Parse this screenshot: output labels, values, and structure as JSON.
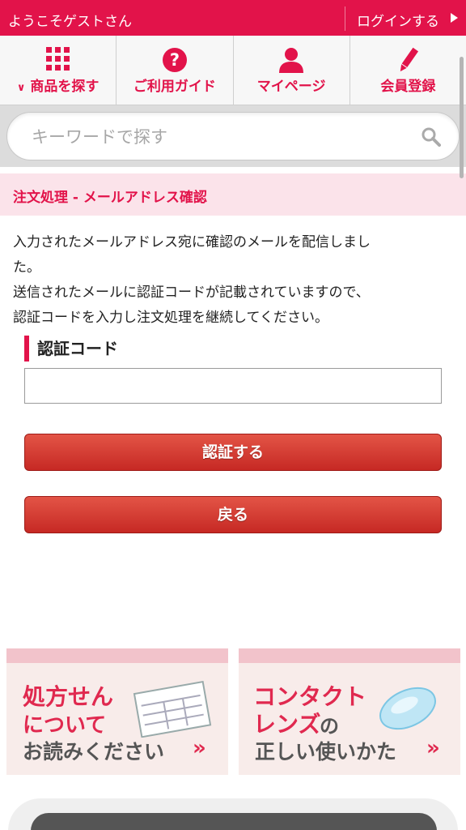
{
  "topbar": {
    "welcome": "ようこそゲストさん",
    "login_label": "ログインする"
  },
  "nav": {
    "items": [
      {
        "label": "商品を探す",
        "icon": "grid-icon"
      },
      {
        "label": "ご利用ガイド",
        "icon": "help-icon"
      },
      {
        "label": "マイページ",
        "icon": "user-icon"
      },
      {
        "label": "会員登録",
        "icon": "pencil-icon"
      }
    ]
  },
  "search": {
    "placeholder": "キーワードで探す",
    "value": ""
  },
  "page": {
    "title": "注文処理 - メールアドレス確認",
    "intro_lines": [
      "入力されたメールアドレス宛に確認のメールを配信しまし",
      "た。",
      "送信されたメールに認証コードが記載されていますので、",
      "認証コードを入力し注文処理を継続してください。"
    ]
  },
  "form": {
    "code_label": "認証コード",
    "code_value": "",
    "submit_label": "認証する",
    "back_label": "戻る"
  },
  "banners": {
    "prescription": {
      "line1": "処方せん",
      "line2": "について",
      "line3": "お読みください",
      "chevron": "»"
    },
    "lens": {
      "line1": "コンタクト",
      "line2": "レンズ",
      "line2b": "の",
      "line3": "正しい使いかた",
      "chevron": "»"
    }
  },
  "colors": {
    "brand": "#e2134a",
    "button": "#d8352c",
    "title_bg": "#fbe3ea"
  }
}
